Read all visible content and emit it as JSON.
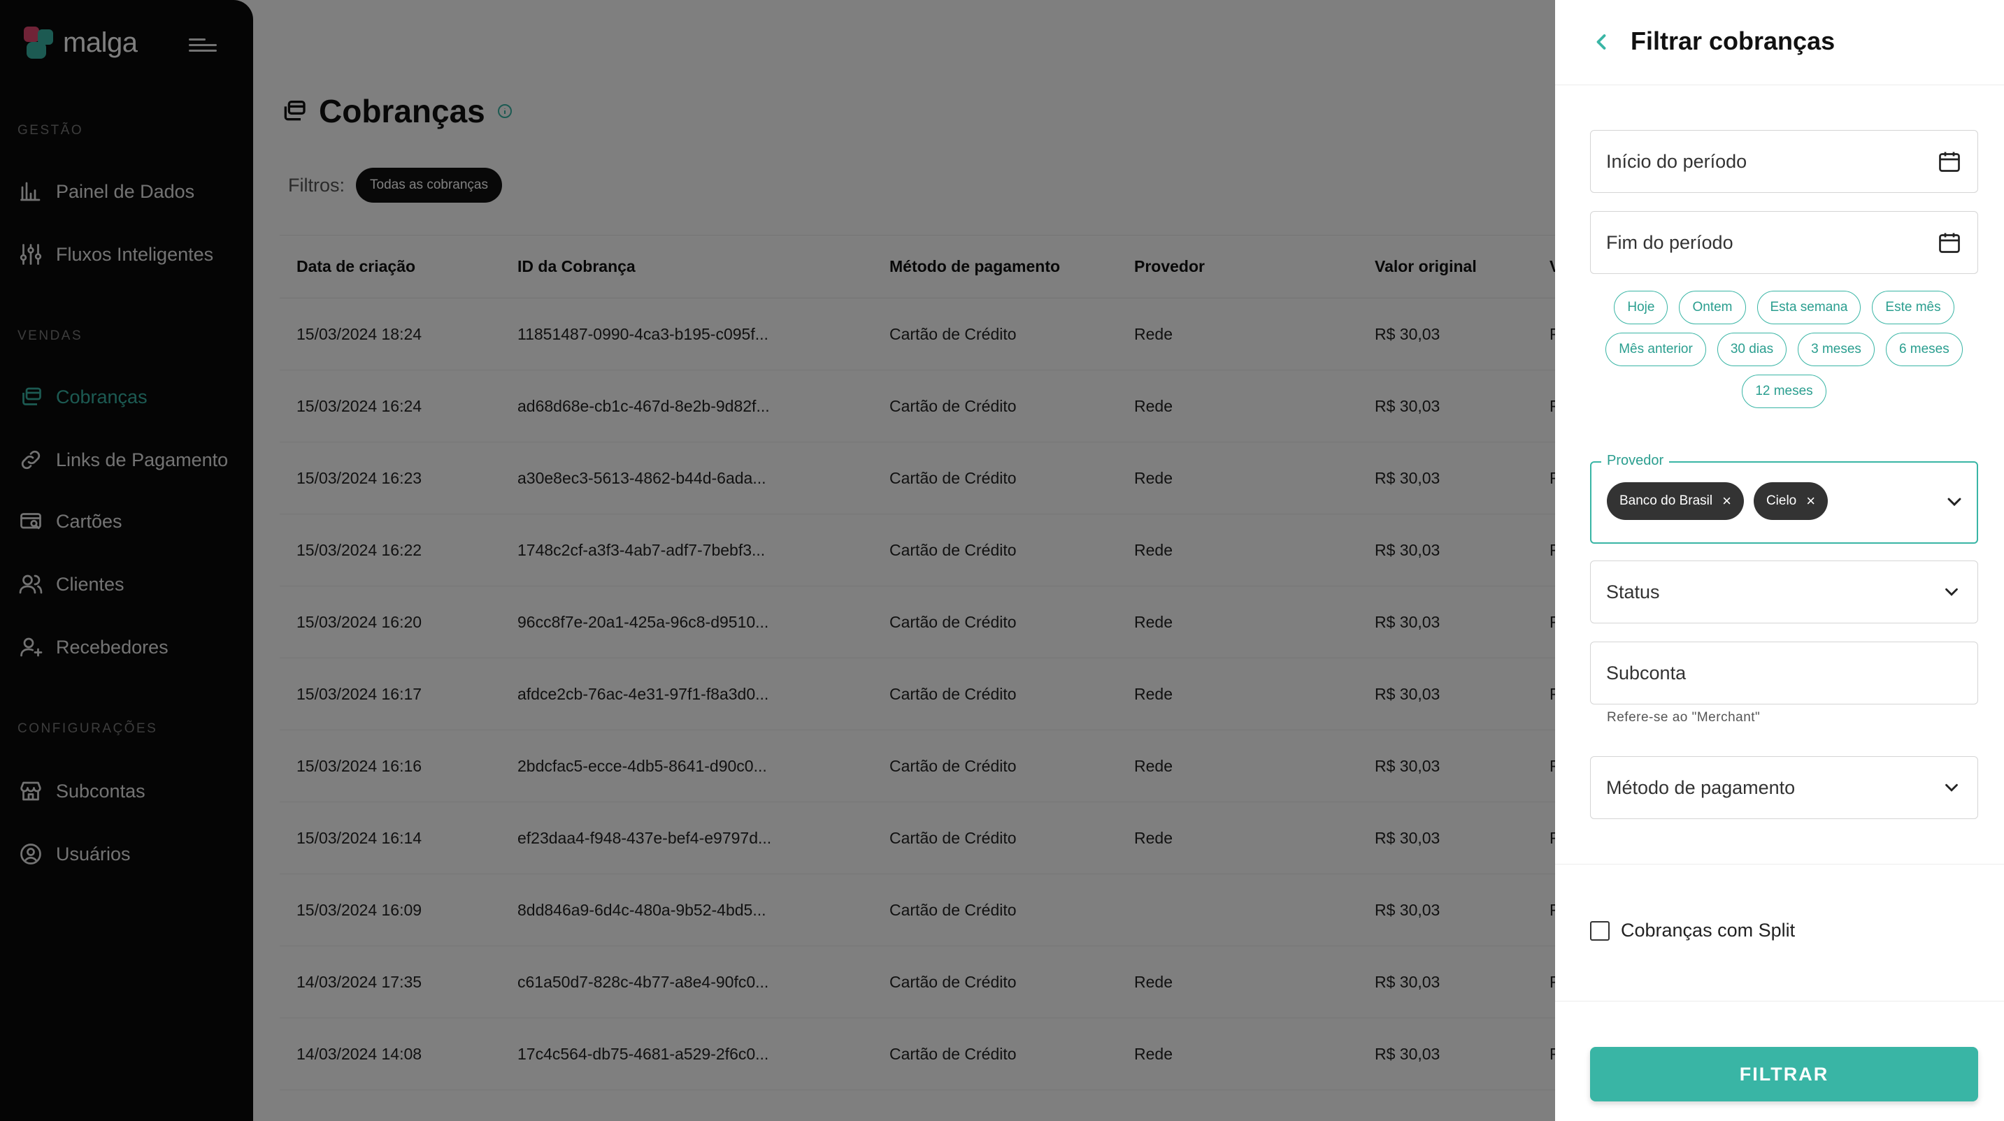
{
  "brand": {
    "name": "malga",
    "accent": "#39b5a5"
  },
  "sidebar": {
    "sections": [
      {
        "label": "GESTÃO"
      },
      {
        "label": "VENDAS"
      },
      {
        "label": "CONFIGURAÇÕES"
      }
    ],
    "items": [
      {
        "label": "Painel de Dados",
        "icon": "bar-chart-icon"
      },
      {
        "label": "Fluxos Inteligentes",
        "icon": "sliders-icon"
      },
      {
        "label": "Cobranças",
        "icon": "charges-icon",
        "active": true
      },
      {
        "label": "Links de Pagamento",
        "icon": "link-icon"
      },
      {
        "label": "Cartões",
        "icon": "card-search-icon"
      },
      {
        "label": "Clientes",
        "icon": "users-icon"
      },
      {
        "label": "Recebedores",
        "icon": "user-plus-icon"
      },
      {
        "label": "Subcontas",
        "icon": "store-icon"
      },
      {
        "label": "Usuários",
        "icon": "user-circle-icon"
      }
    ]
  },
  "main": {
    "title": "Cobranças",
    "filters_label": "Filtros:",
    "active_filter": "Todas as cobranças",
    "table": {
      "columns": [
        "Data de criação",
        "ID da Cobrança",
        "Método de pagamento",
        "Provedor",
        "Valor original",
        "V"
      ],
      "rows": [
        [
          "15/03/2024 18:24",
          "11851487-0990-4ca3-b195-c095f...",
          "Cartão de Crédito",
          "Rede",
          "R$ 30,03",
          "R"
        ],
        [
          "15/03/2024 16:24",
          "ad68d68e-cb1c-467d-8e2b-9d82f...",
          "Cartão de Crédito",
          "Rede",
          "R$ 30,03",
          "R"
        ],
        [
          "15/03/2024 16:23",
          "a30e8ec3-5613-4862-b44d-6ada...",
          "Cartão de Crédito",
          "Rede",
          "R$ 30,03",
          "R"
        ],
        [
          "15/03/2024 16:22",
          "1748c2cf-a3f3-4ab7-adf7-7bebf3...",
          "Cartão de Crédito",
          "Rede",
          "R$ 30,03",
          "R"
        ],
        [
          "15/03/2024 16:20",
          "96cc8f7e-20a1-425a-96c8-d9510...",
          "Cartão de Crédito",
          "Rede",
          "R$ 30,03",
          "R"
        ],
        [
          "15/03/2024 16:17",
          "afdce2cb-76ac-4e31-97f1-f8a3d0...",
          "Cartão de Crédito",
          "Rede",
          "R$ 30,03",
          "R"
        ],
        [
          "15/03/2024 16:16",
          "2bdcfac5-ecce-4db5-8641-d90c0...",
          "Cartão de Crédito",
          "Rede",
          "R$ 30,03",
          "R"
        ],
        [
          "15/03/2024 16:14",
          "ef23daa4-f948-437e-bef4-e9797d...",
          "Cartão de Crédito",
          "Rede",
          "R$ 30,03",
          "R"
        ],
        [
          "15/03/2024 16:09",
          "8dd846a9-6d4c-480a-9b52-4bd5...",
          "Cartão de Crédito",
          "",
          "R$ 30,03",
          "R"
        ],
        [
          "14/03/2024 17:35",
          "c61a50d7-828c-4b77-a8e4-90fc0...",
          "Cartão de Crédito",
          "Rede",
          "R$ 30,03",
          "R"
        ],
        [
          "14/03/2024 14:08",
          "17c4c564-db75-4681-a529-2f6c0...",
          "Cartão de Crédito",
          "Rede",
          "R$ 30,03",
          "R"
        ]
      ]
    }
  },
  "drawer": {
    "title": "Filtrar cobranças",
    "start_period_placeholder": "Início do período",
    "end_period_placeholder": "Fim do período",
    "quick_ranges": [
      "Hoje",
      "Ontem",
      "Esta semana",
      "Este mês",
      "Mês anterior",
      "30 dias",
      "3 meses",
      "6 meses",
      "12 meses"
    ],
    "provider_label": "Provedor",
    "provider_selected": [
      "Banco do Brasil",
      "Cielo"
    ],
    "status_label": "Status",
    "subconta_label": "Subconta",
    "subconta_helper": "Refere-se ao \"Merchant\"",
    "payment_method_label": "Método de pagamento",
    "split_checkbox_label": "Cobranças com Split",
    "split_checked": false,
    "submit_label": "FILTRAR"
  }
}
